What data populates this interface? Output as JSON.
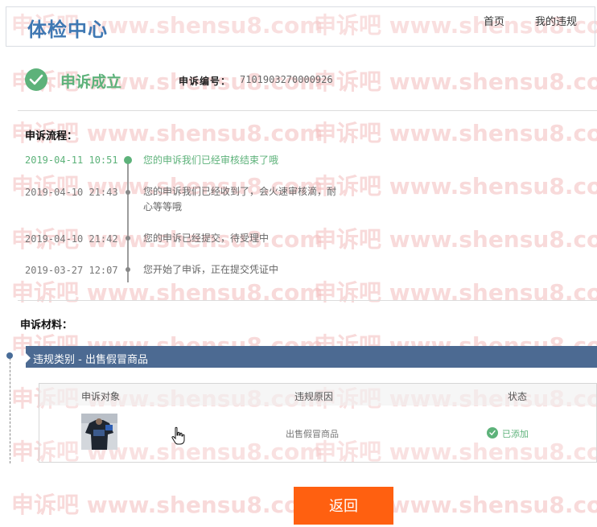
{
  "watermark": {
    "text_cn": "申诉吧",
    "text_url": "www.shensu8.com"
  },
  "header": {
    "site_title": "体检中心",
    "nav": {
      "home": "首页",
      "my_violations": "我的违规"
    }
  },
  "status": {
    "label": "申诉成立",
    "appeal_number_label": "申诉编号：",
    "appeal_number": "7101903270000926"
  },
  "process": {
    "title": "申诉流程：",
    "steps": [
      {
        "time": "2019-04-11 10:51",
        "text": "您的申诉我们已经审核结束了哦",
        "active": true
      },
      {
        "time": "2019-04-10 21:43",
        "text": "您的申诉我们已经收到了，会火速审核滴，耐心等等哦",
        "active": false
      },
      {
        "time": "2019-04-10 21:42",
        "text": "您的申诉已经提交，待受理中",
        "active": false
      },
      {
        "time": "2019-03-27 12:07",
        "text": "您开始了申诉，正在提交凭证中",
        "active": false
      }
    ]
  },
  "materials": {
    "title": "申诉材料：",
    "category_label": "违规类别 - 出售假冒商品",
    "table": {
      "headers": [
        "申诉对象",
        "违规原因",
        "状态"
      ],
      "rows": [
        {
          "reason": "出售假冒商品",
          "status": "已添加"
        }
      ]
    }
  },
  "actions": {
    "back": "返回"
  },
  "colors": {
    "accent_green": "#5db27a",
    "title_blue": "#3f78b3",
    "category_bar": "#4c6a92",
    "button_orange": "#ff6010"
  }
}
